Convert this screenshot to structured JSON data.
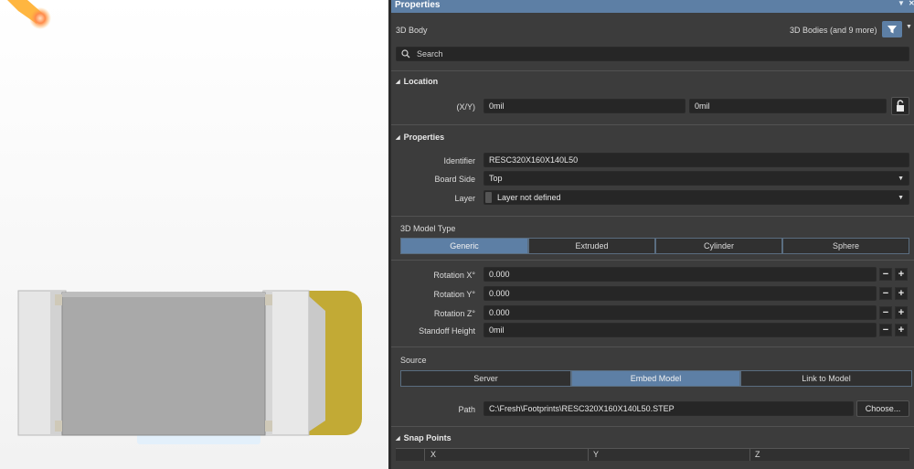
{
  "panel": {
    "title": "Properties",
    "object_type": "3D Body",
    "filter_text": "3D Bodies (and 9 more)",
    "search_placeholder": "Search"
  },
  "location": {
    "header": "Location",
    "xy_label": "(X/Y)",
    "x_value": "0mil",
    "y_value": "0mil"
  },
  "properties": {
    "header": "Properties",
    "identifier_label": "Identifier",
    "identifier_value": "RESC320X160X140L50",
    "board_side_label": "Board Side",
    "board_side_value": "Top",
    "layer_label": "Layer",
    "layer_value": "Layer not defined"
  },
  "model_type": {
    "header": "3D Model Type",
    "options": [
      "Generic",
      "Extruded",
      "Cylinder",
      "Sphere"
    ],
    "selected": "Generic"
  },
  "rotation": {
    "rx_label": "Rotation X°",
    "rx_value": "0.000",
    "ry_label": "Rotation Y°",
    "ry_value": "0.000",
    "rz_label": "Rotation Z°",
    "rz_value": "0.000",
    "standoff_label": "Standoff Height",
    "standoff_value": "0mil",
    "minus": "−",
    "plus": "+"
  },
  "source": {
    "header": "Source",
    "options": [
      "Server",
      "Embed Model",
      "Link to Model"
    ],
    "selected": "Embed Model",
    "path_label": "Path",
    "path_value": "C:\\Fresh\\Footprints\\RESC320X160X140L50.STEP",
    "choose_label": "Choose..."
  },
  "snap_points": {
    "header": "Snap Points",
    "columns": [
      "X",
      "Y",
      "Z"
    ]
  },
  "colors": {
    "accent": "#5d7fa5",
    "panel_bg": "#3c3c3c",
    "field_bg": "#262626",
    "body_gray": "#a8a8a8",
    "cap_white": "#e4e4e4",
    "pad_gold": "#c2aa35",
    "light_orange": "#ff9a3c"
  }
}
